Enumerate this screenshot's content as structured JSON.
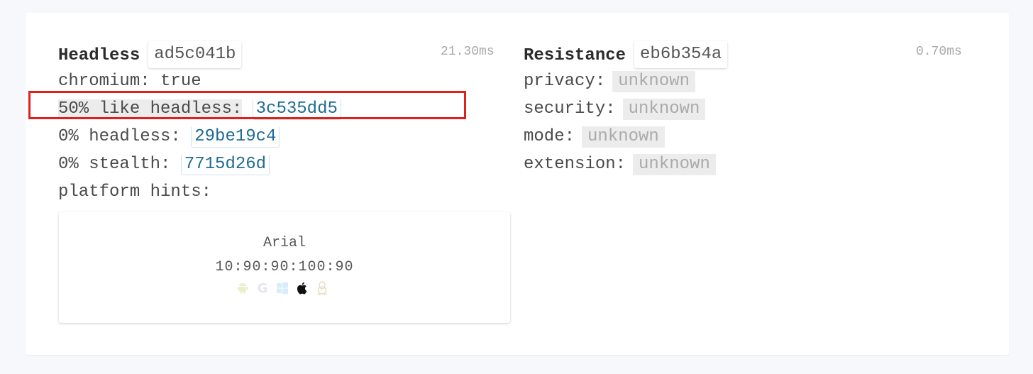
{
  "headless": {
    "title": "Headless",
    "hash": "ad5c041b",
    "time": "21.30ms",
    "chromium_label": "chromium:",
    "chromium_value": "true",
    "like_headless_label": "50% like headless:",
    "like_headless_hash": "3c535dd5",
    "headless_label": "0% headless:",
    "headless_hash": "29be19c4",
    "stealth_label": "0% stealth:",
    "stealth_hash": "7715d26d",
    "platform_hints_label": "platform hints:",
    "font_card": {
      "font_name": "Arial",
      "metrics": "10:90:90:100:90",
      "icons": [
        "android-icon",
        "google-icon",
        "windows-icon",
        "apple-icon",
        "linux-icon"
      ],
      "active_icon": "apple-icon"
    }
  },
  "resistance": {
    "title": "Resistance",
    "hash": "eb6b354a",
    "time": "0.70ms",
    "privacy_label": "privacy:",
    "privacy_value": "unknown",
    "security_label": "security:",
    "security_value": "unknown",
    "mode_label": "mode:",
    "mode_value": "unknown",
    "extension_label": "extension:",
    "extension_value": "unknown"
  },
  "colors": {
    "highlight_box": "#e0201b",
    "link": "#1f6b94",
    "muted": "#aaaaaa"
  }
}
